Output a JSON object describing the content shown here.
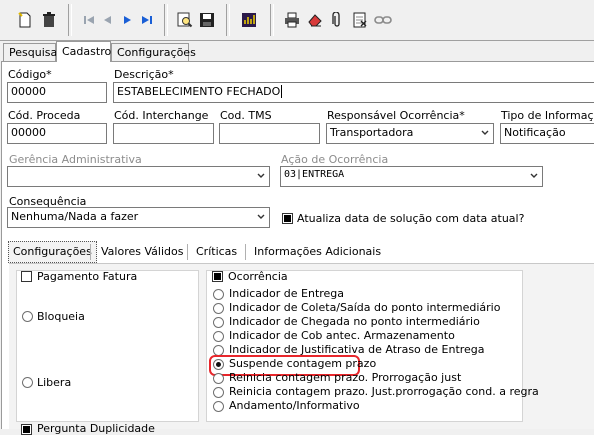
{
  "toolbar": {
    "buttons": [
      {
        "icon": "new-document-icon"
      },
      {
        "icon": "trash-icon"
      },
      {
        "icon": "first-record-icon"
      },
      {
        "icon": "previous-record-icon"
      },
      {
        "icon": "next-record-icon"
      },
      {
        "icon": "last-record-icon"
      },
      {
        "icon": "search-record-icon"
      },
      {
        "icon": "save-icon"
      },
      {
        "icon": "report-icon"
      },
      {
        "icon": "print-icon"
      },
      {
        "icon": "eraser-icon"
      },
      {
        "icon": "attachment-icon"
      },
      {
        "icon": "spreadsheet-icon"
      },
      {
        "icon": "link-icon"
      }
    ]
  },
  "tabs": [
    {
      "label": "Pesquisa"
    },
    {
      "label": "Cadastro",
      "active": true
    },
    {
      "label": "Configurações"
    }
  ],
  "form": {
    "codigo": {
      "label": "Código*",
      "value": "00000"
    },
    "descricao": {
      "label": "Descrição*",
      "value": "ESTABELECIMENTO FECHADO"
    },
    "cod_proceda": {
      "label": "Cód. Proceda",
      "value": "00000"
    },
    "cod_interchange": {
      "label": "Cód. Interchange",
      "value": ""
    },
    "cod_tms": {
      "label": "Cod. TMS",
      "value": ""
    },
    "responsavel": {
      "label": "Responsável Ocorrência*",
      "value": "Transportadora"
    },
    "tipo_info": {
      "label": "Tipo de Informação*",
      "value": "Notificação"
    },
    "gerencia": {
      "label": "Gerência Administrativa",
      "value": ""
    },
    "acao": {
      "label": "Ação de Ocorrência",
      "value": "03|ENTREGA"
    },
    "consequencia": {
      "label": "Consequência",
      "value": "Nenhuma/Nada a fazer"
    },
    "atualiza_data": {
      "label": "Atualiza data de solução com data atual?",
      "checked": true
    }
  },
  "subtabs": [
    {
      "label": "Configurações",
      "active": true
    },
    {
      "label": "Valores Válidos"
    },
    {
      "label": "Críticas"
    },
    {
      "label": "Informações Adicionais"
    }
  ],
  "left_group": {
    "pagamento_fatura": {
      "label": "Pagamento Fatura",
      "checked": false
    },
    "radios": [
      {
        "label": "Bloqueia",
        "selected": false
      },
      {
        "label": "Libera",
        "selected": false
      }
    ]
  },
  "right_group": {
    "ocorrencia": {
      "label": "Ocorrência",
      "checked": true
    },
    "radios": [
      {
        "label": "Indicador de Entrega",
        "selected": false
      },
      {
        "label": "Indicador de Coleta/Saída do ponto intermediário",
        "selected": false
      },
      {
        "label": "Indicador de Chegada no ponto intermediário",
        "selected": false
      },
      {
        "label": "Indicador de Cob antec. Armazenamento",
        "selected": false
      },
      {
        "label": "Indicador de Justificativa de Atraso de Entrega",
        "selected": false
      },
      {
        "label": "Suspende contagem prazo",
        "selected": true
      },
      {
        "label": "Reinicia contagem prazo. Prorrogação just",
        "selected": false
      },
      {
        "label": "Reinicia contagem prazo. Just.prorrogação cond. a regra",
        "selected": false
      },
      {
        "label": "Andamento/Informativo",
        "selected": false
      }
    ]
  },
  "bottom_cut_label": "Pergunta Duplicidade"
}
